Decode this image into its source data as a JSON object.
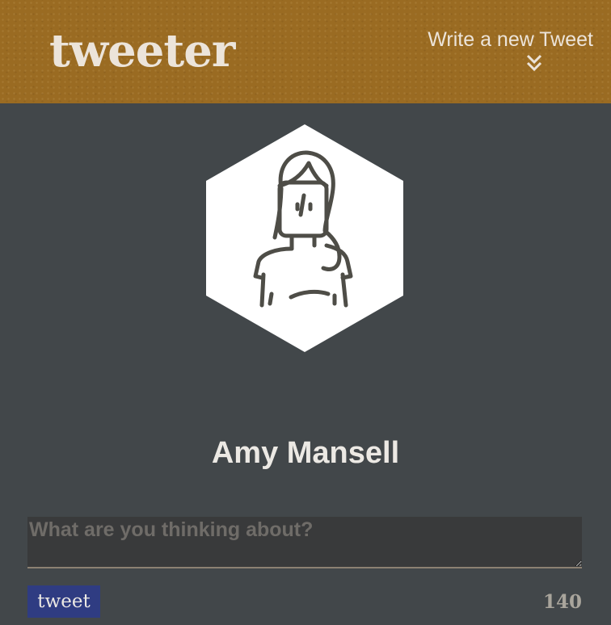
{
  "header": {
    "logo": "tweeter",
    "compose_label": "Write a new Tweet",
    "compose_icon": "double-chevron-down-icon"
  },
  "profile": {
    "avatar_icon": "woman-avatar-icon",
    "name": "Amy Mansell"
  },
  "composer": {
    "placeholder": "What are you thinking about?",
    "value": "",
    "submit_label": "tweet",
    "char_count": "140"
  },
  "colors": {
    "header_bg": "#9a6b22",
    "page_bg": "#42474a",
    "button_bg": "#2f3c82",
    "input_bg": "#393a3b"
  }
}
